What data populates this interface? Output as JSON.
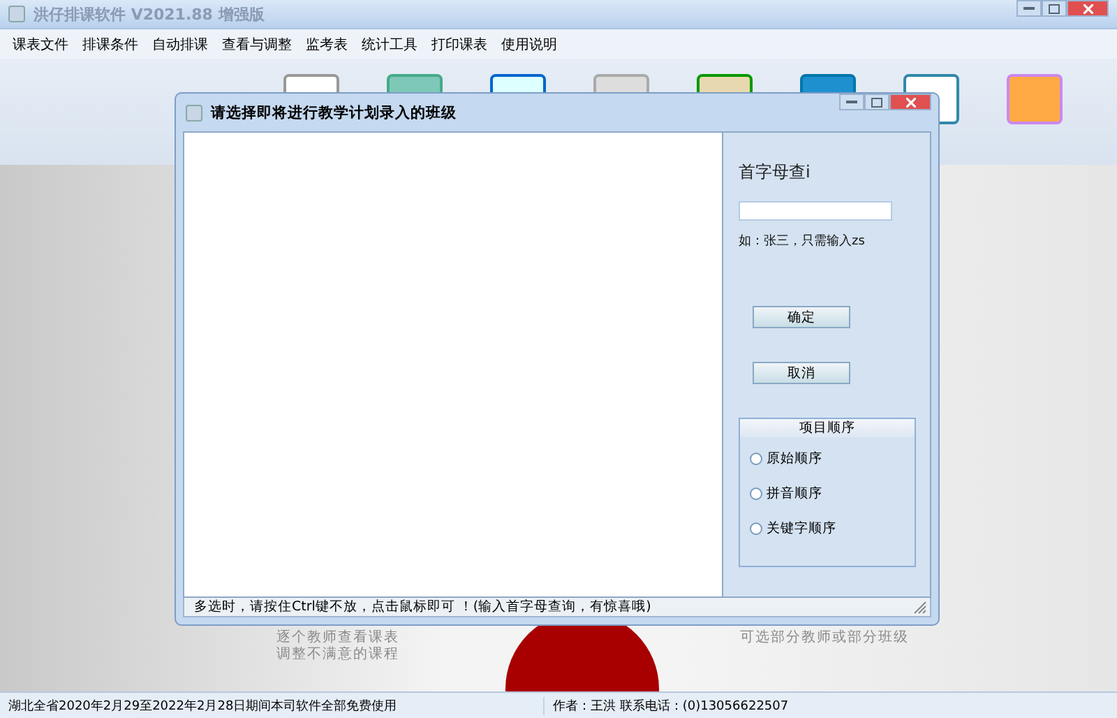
{
  "window": {
    "title": "洪仔排课软件 V2021.88 增强版"
  },
  "menu": [
    "课表文件",
    "排课条件",
    "自动排课",
    "查看与调整",
    "监考表",
    "统计工具",
    "打印课表",
    "使用说明"
  ],
  "background_left": [
    "逐个教师查看课表",
    "调整不满意的课程"
  ],
  "background_right": [
    "可选部分教师或部分班级"
  ],
  "dialog": {
    "title": "请选择即将进行教学计划录入的班级",
    "search_label": "首字母查i",
    "hint": "如：张三，只需输入zs",
    "buttons": [
      "确定",
      "取消"
    ],
    "order_group": {
      "title": "项目顺序",
      "options": [
        {
          "label": "原始顺序",
          "selected": false
        },
        {
          "label": "拼音顺序",
          "selected": false
        },
        {
          "label": "关键字顺序",
          "selected": false
        }
      ]
    },
    "status": "多选时，请按住Ctrl键不放，点击鼠标即可 ！(输入首字母查询，有惊喜哦)"
  },
  "status_bar": [
    "湖北全省2020年2月29至2022年2月28日期间本司软件全部免费使用",
    "作者：王洪  联系电话：(0)13056622507"
  ]
}
